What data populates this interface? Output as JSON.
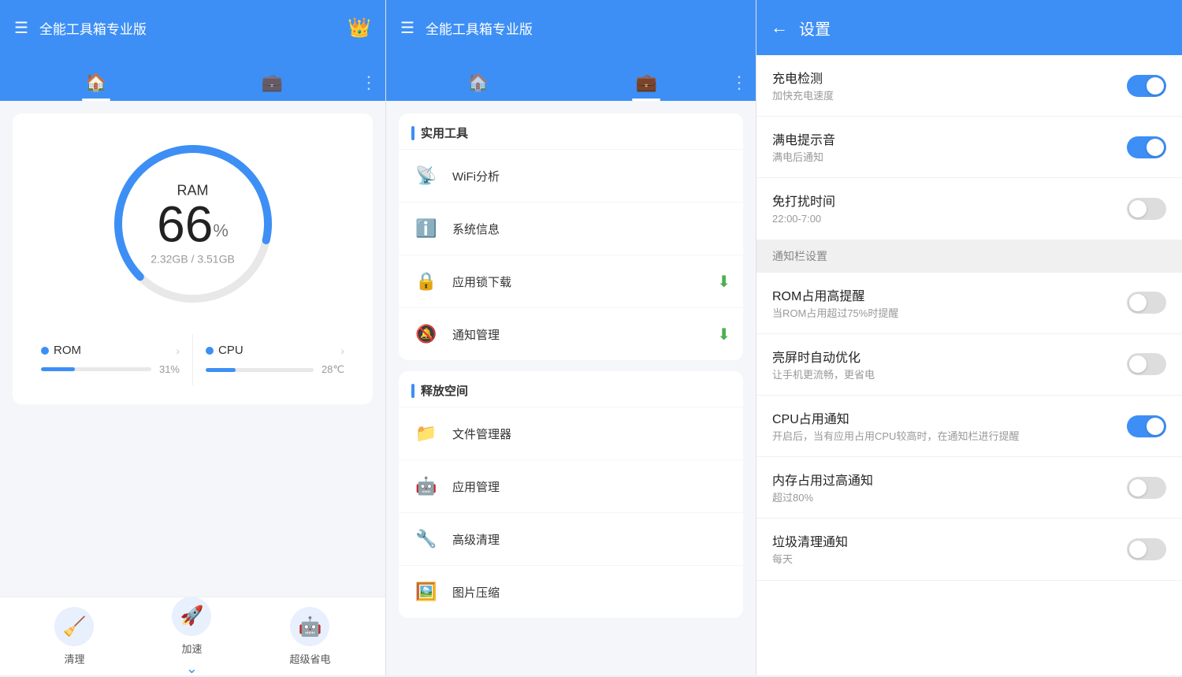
{
  "panel1": {
    "header": {
      "menu_label": "☰",
      "title": "全能工具箱专业版",
      "crown_icon": "👑"
    },
    "tabs": [
      {
        "label": "🏠",
        "active": true,
        "name": "home"
      },
      {
        "label": "💼",
        "active": false,
        "name": "tools"
      },
      {
        "label": "⋮",
        "active": false,
        "name": "more"
      }
    ],
    "ram_card": {
      "label": "RAM",
      "percent": "66",
      "percent_sign": "%",
      "memory_used": "2.32GB",
      "memory_total": "3.51GB",
      "memory_text": "2.32GB / 3.51GB"
    },
    "stats": [
      {
        "name": "ROM",
        "dot_color": "#3d8ff5",
        "bar_percent": 31,
        "value": "31%"
      },
      {
        "name": "CPU",
        "dot_color": "#3d8ff5",
        "bar_percent": 28,
        "value": "28℃"
      }
    ],
    "actions": [
      {
        "label": "清理",
        "icon": "🧹"
      },
      {
        "label": "加速",
        "icon": "🚀"
      },
      {
        "label": "超级省电",
        "icon": "🤖"
      }
    ]
  },
  "panel2": {
    "header": {
      "menu_label": "☰",
      "title": "全能工具箱专业版"
    },
    "tabs": [
      {
        "label": "🏠",
        "active": false,
        "name": "home"
      },
      {
        "label": "💼",
        "active": true,
        "name": "tools"
      },
      {
        "label": "⋮",
        "active": false,
        "name": "more"
      }
    ],
    "sections": [
      {
        "title": "实用工具",
        "items": [
          {
            "icon": "📡",
            "name": "WiFi分析",
            "badge": "",
            "badge_class": ""
          },
          {
            "icon": "ℹ️",
            "name": "系统信息",
            "badge": "",
            "badge_class": ""
          },
          {
            "icon": "🔒",
            "name": "应用锁下载",
            "badge": "⬇",
            "badge_class": "tool-badge-green"
          },
          {
            "icon": "🔕",
            "name": "通知管理",
            "badge": "⬇",
            "badge_class": "tool-badge-green"
          }
        ]
      },
      {
        "title": "释放空间",
        "items": [
          {
            "icon": "📁",
            "name": "文件管理器",
            "badge": "",
            "badge_class": ""
          },
          {
            "icon": "🤖",
            "name": "应用管理",
            "badge": "",
            "badge_class": ""
          },
          {
            "icon": "🔧",
            "name": "高级清理",
            "badge": "",
            "badge_class": ""
          },
          {
            "icon": "🖼️",
            "name": "图片压缩",
            "badge": "",
            "badge_class": ""
          }
        ]
      }
    ]
  },
  "panel3": {
    "header": {
      "back_icon": "←",
      "title": "设置"
    },
    "settings": [
      {
        "type": "toggle",
        "name": "充电检测",
        "desc": "加快充电速度",
        "state": "on"
      },
      {
        "type": "toggle",
        "name": "满电提示音",
        "desc": "满电后通知",
        "state": "on"
      },
      {
        "type": "toggle",
        "name": "免打扰时间",
        "desc": "22:00-7:00",
        "state": "off"
      },
      {
        "type": "section",
        "name": "通知栏设置",
        "desc": ""
      },
      {
        "type": "toggle",
        "name": "ROM占用高提醒",
        "desc": "当ROM占用超过75%时提醒",
        "state": "off"
      },
      {
        "type": "toggle",
        "name": "亮屏时自动优化",
        "desc": "让手机更流畅，更省电",
        "state": "off"
      },
      {
        "type": "toggle",
        "name": "CPU占用通知",
        "desc": "开启后，当有应用占用CPU较高时，在通知栏进行提醒",
        "state": "on"
      },
      {
        "type": "toggle",
        "name": "内存占用过高通知",
        "desc": "超过80%",
        "state": "off"
      },
      {
        "type": "toggle",
        "name": "垃圾清理通知",
        "desc": "每天",
        "state": "off"
      }
    ]
  }
}
